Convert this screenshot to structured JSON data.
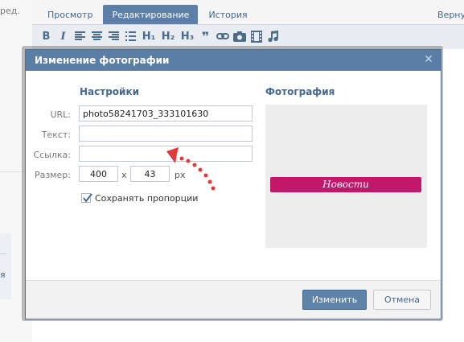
{
  "background": {
    "left_label": "ред.",
    "left_char": "я",
    "tabs": [
      {
        "label": "Просмотр",
        "active": false
      },
      {
        "label": "Редактирование",
        "active": true
      },
      {
        "label": "История",
        "active": false
      }
    ],
    "return_link": "Вернуться",
    "toolbar_icons": [
      "bold-icon",
      "italic-icon",
      "align-left-icon",
      "align-center-icon",
      "align-right-icon",
      "list-icon",
      "h1-icon",
      "h2-icon",
      "h3-icon",
      "quote-icon",
      "link-icon",
      "photo-icon",
      "video-icon",
      "audio-icon"
    ],
    "toolbar_text": {
      "bold": "B",
      "italic": "I",
      "h1": "H₁",
      "h2": "H₂",
      "h3": "H₃",
      "quote": "❞"
    }
  },
  "dialog": {
    "title": "Изменение фотографии",
    "settings_title": "Настройки",
    "photo_title": "Фотография",
    "fields": {
      "url_label": "URL:",
      "url_value": "photo58241703_333101630",
      "text_label": "Текст:",
      "text_value": "",
      "link_label": "Ссылка:",
      "link_value": "",
      "size_label": "Размер:",
      "width_value": "400",
      "size_separator": "x",
      "height_value": "43",
      "size_unit": "px"
    },
    "keep_proportions": {
      "label": "Сохранять пропорции",
      "checked": true
    },
    "preview_banner_text": "Новости",
    "buttons": {
      "save": "Изменить",
      "cancel": "Отмена"
    }
  },
  "colors": {
    "header": "#5b7ea6",
    "accent_text": "#45688e",
    "banner": "#c2186b",
    "arrow": "#e03a3a"
  }
}
